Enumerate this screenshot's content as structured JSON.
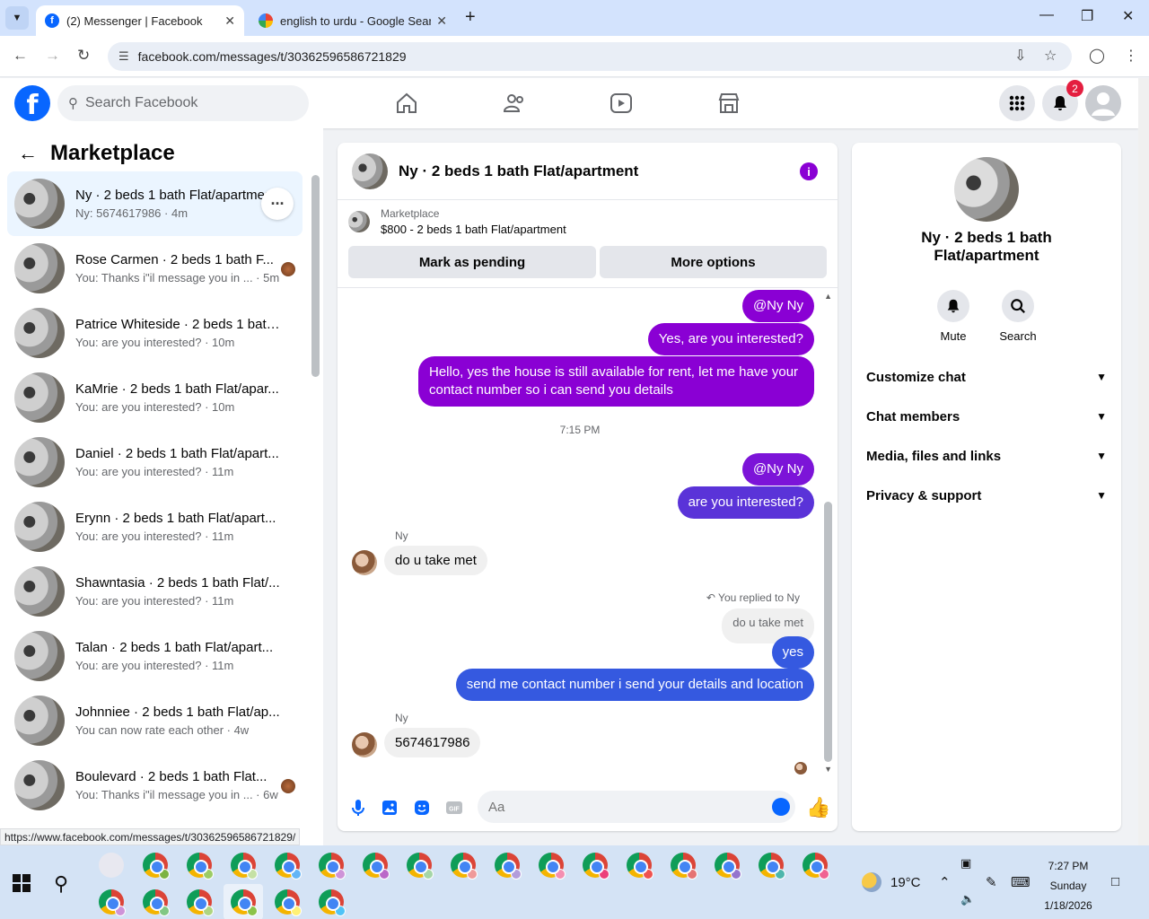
{
  "browser": {
    "tabs": [
      {
        "title": "(2) Messenger | Facebook",
        "favicon": "facebook-icon",
        "active": true
      },
      {
        "title": "english to urdu - Google Searc",
        "favicon": "google-icon",
        "active": false
      }
    ],
    "url": "facebook.com/messages/t/30362596586721829",
    "status_url": "https://www.facebook.com/messages/t/30362596586721829/"
  },
  "fb_header": {
    "logo": "f",
    "search_placeholder": "Search Facebook",
    "notification_count": "2",
    "colors": {
      "brand": "#0866ff",
      "badge": "#e41e3f"
    }
  },
  "left_panel": {
    "title": "Marketplace",
    "conversations": [
      {
        "name": "Ny · 2 beds 1 bath Flat/apartment",
        "preview": "Ny: 5674617986 · 4m",
        "active": true
      },
      {
        "name": "Rose Carmen · 2 beds 1 bath F...",
        "preview": "You: Thanks i\"il message you in ... · 5m",
        "seen_avatar": true
      },
      {
        "name": "Patrice Whiteside · 2 beds 1 bath...",
        "preview": "You: are you interested? · 10m"
      },
      {
        "name": "KaMrie · 2 beds 1 bath Flat/apar...",
        "preview": "You: are you interested? · 10m"
      },
      {
        "name": "Daniel · 2 beds 1 bath Flat/apart...",
        "preview": "You: are you interested? · 11m"
      },
      {
        "name": "Erynn · 2 beds 1 bath Flat/apart...",
        "preview": "You: are you interested? · 11m"
      },
      {
        "name": "Shawntasia · 2 beds 1 bath Flat/...",
        "preview": "You: are you interested? · 11m"
      },
      {
        "name": "Talan · 2 beds 1 bath Flat/apart...",
        "preview": "You: are you interested? · 11m"
      },
      {
        "name": "Johnniee · 2 beds 1 bath Flat/ap...",
        "preview": "You can now rate each other · 4w"
      },
      {
        "name": "Boulevard · 2 beds 1 bath Flat...",
        "preview": "You: Thanks i\"il message you in ... · 6w",
        "seen_avatar": true
      }
    ]
  },
  "chat": {
    "title": "Ny · 2 beds 1 bath Flat/apartment",
    "listing": {
      "category": "Marketplace",
      "title": "$800 - 2 beds 1 bath Flat/apartment"
    },
    "buttons": {
      "mark_pending": "Mark as pending",
      "more_options": "More options"
    },
    "messages": {
      "m1": "@Ny Ny",
      "m2": "Yes, are you interested?",
      "m3_line1": "Hello, yes the house is still available for rent, let me have your",
      "m3_line2": "contact number so i can send you details",
      "time": "7:15 PM",
      "m4": "@Ny Ny",
      "m5": "are you interested?",
      "sender1": "Ny",
      "in1": "do u take met",
      "replied_label": "You replied to Ny",
      "quoted": "do u take met",
      "m6": "yes",
      "m7": "send me contact number i send your details and location",
      "sender2": "Ny",
      "in2": "5674617986"
    },
    "composer_placeholder": "Aa",
    "colors": {
      "outgoing": "#8a00d4",
      "outgoing_blue": "#3559e0",
      "incoming": "#f0f0f0"
    }
  },
  "right_panel": {
    "name_line1": "Ny · 2 beds 1 bath",
    "name_line2": "Flat/apartment",
    "actions": {
      "mute": "Mute",
      "search": "Search"
    },
    "sections": [
      "Customize chat",
      "Chat members",
      "Media, files and links",
      "Privacy & support"
    ]
  },
  "taskbar": {
    "weather": "19°C",
    "time": "7:27 PM",
    "day": "Sunday",
    "date": "1/18/2026"
  }
}
